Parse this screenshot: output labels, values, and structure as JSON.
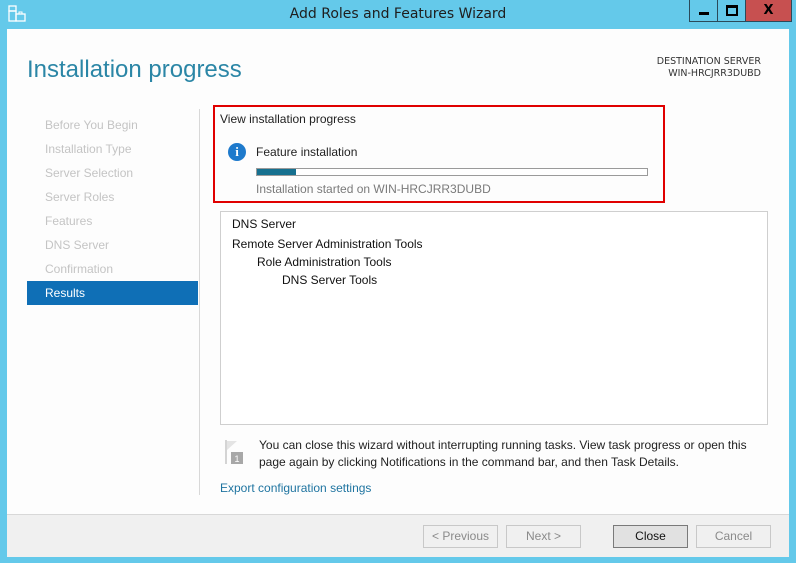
{
  "window": {
    "title": "Add Roles and Features Wizard",
    "controls": {
      "minimize": "minimize",
      "maximize": "maximize",
      "close": "X"
    }
  },
  "header": {
    "title": "Installation progress",
    "destination_label": "DESTINATION SERVER",
    "destination_server": "WIN-HRCJRR3DUBD"
  },
  "nav": {
    "items": [
      {
        "label": "Before You Begin",
        "active": false
      },
      {
        "label": "Installation Type",
        "active": false
      },
      {
        "label": "Server Selection",
        "active": false
      },
      {
        "label": "Server Roles",
        "active": false
      },
      {
        "label": "Features",
        "active": false
      },
      {
        "label": "DNS Server",
        "active": false
      },
      {
        "label": "Confirmation",
        "active": false
      },
      {
        "label": "Results",
        "active": true
      }
    ]
  },
  "progress": {
    "view_label": "View installation progress",
    "icon": "info-icon",
    "feature_label": "Feature installation",
    "percent": 10,
    "status": "Installation started on WIN-HRCJRR3DUBD"
  },
  "results": {
    "items": [
      {
        "label": "DNS Server",
        "level": 0
      },
      {
        "label": "Remote Server Administration Tools",
        "level": 0
      },
      {
        "label": "Role Administration Tools",
        "level": 1
      },
      {
        "label": "DNS Server Tools",
        "level": 2
      }
    ]
  },
  "notice": {
    "icon": "notification-flag-icon",
    "badge": "1",
    "text": "You can close this wizard without interrupting running tasks. View task progress or open this page again by clicking Notifications in the command bar, and then Task Details."
  },
  "export_link": "Export configuration settings",
  "buttons": {
    "previous": "< Previous",
    "next": "Next >",
    "close": "Close",
    "cancel": "Cancel"
  },
  "colors": {
    "titlebar": "#64c9ea",
    "accent": "#0f6fb6",
    "progress_fill": "#16708f",
    "highlight_border": "#e00000"
  }
}
